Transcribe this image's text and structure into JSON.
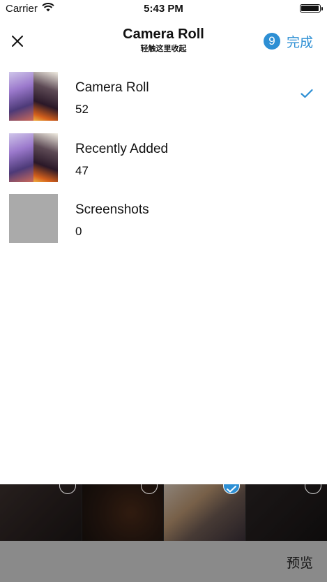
{
  "status_bar": {
    "carrier": "Carrier",
    "time": "5:43 PM",
    "battery_level": 0.9
  },
  "nav": {
    "title": "Camera Roll",
    "subtitle": "轻触这里收起",
    "selected_count": "9",
    "done_label": "完成",
    "accent_color": "#2d8fd4"
  },
  "albums": [
    {
      "name": "Camera Roll",
      "count": "52",
      "selected": true,
      "thumb": "anime-collage"
    },
    {
      "name": "Recently Added",
      "count": "47",
      "selected": false,
      "thumb": "anime-collage"
    },
    {
      "name": "Screenshots",
      "count": "0",
      "selected": false,
      "thumb": "empty-gray"
    }
  ],
  "photo_strip": [
    {
      "image": "manga-cover",
      "selected": false
    },
    {
      "image": "dark-orange-art",
      "selected": false
    },
    {
      "image": "anime-portrait",
      "selected": true
    },
    {
      "image": "dark-sketch",
      "selected": false
    }
  ],
  "toolbar": {
    "preview_label": "预览"
  }
}
